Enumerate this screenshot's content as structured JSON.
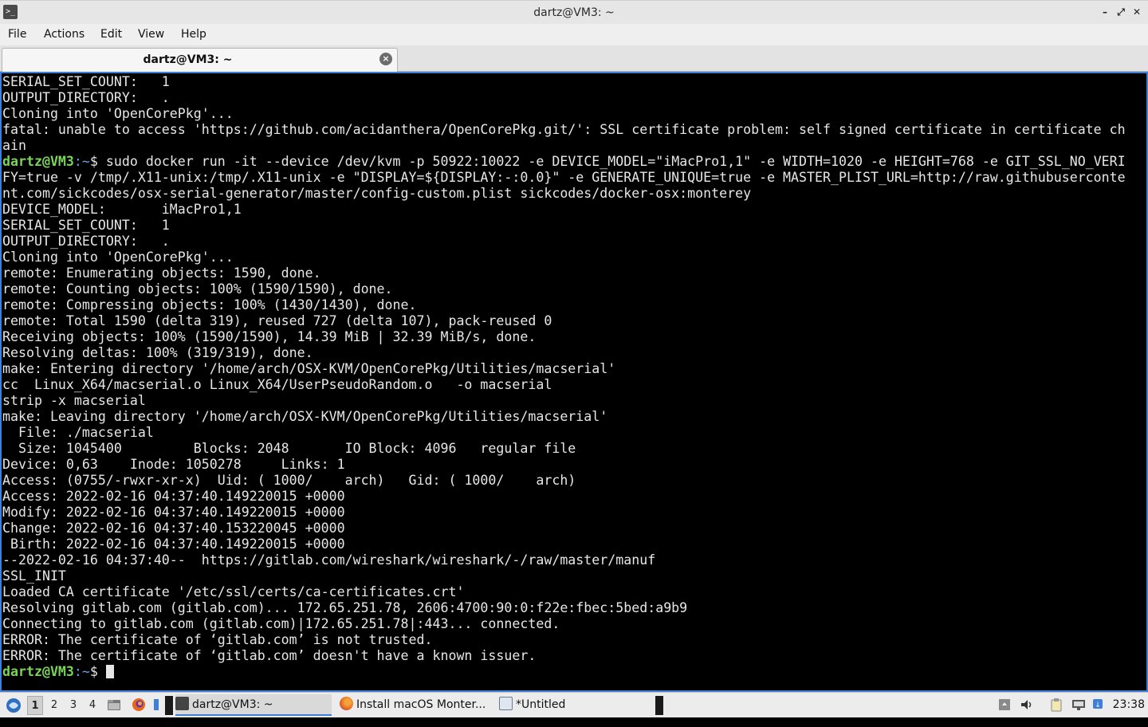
{
  "window": {
    "title": "dartz@VM3: ~",
    "app_icon": "terminal-icon",
    "controls": [
      "minimize-icon",
      "maximize-icon",
      "close-icon"
    ]
  },
  "menubar": {
    "items": [
      "File",
      "Actions",
      "Edit",
      "View",
      "Help"
    ]
  },
  "tabs": [
    {
      "label": "dartz@VM3: ~",
      "close_icon": "close-circle-icon"
    }
  ],
  "terminal": {
    "prompt_user": "dartz@VM3",
    "prompt_path": ":~",
    "prompt_symbol": "$",
    "colors": {
      "background": "#000000",
      "text": "#e6e6e6",
      "prompt_user": "#7cd35a",
      "prompt_path": "#6a9fe6",
      "border": "#3d7fd9"
    },
    "lines": [
      {
        "text": "SERIAL_SET_COUNT:   1"
      },
      {
        "text": "OUTPUT_DIRECTORY:   ."
      },
      {
        "text": "Cloning into 'OpenCorePkg'..."
      },
      {
        "text": "fatal: unable to access 'https://github.com/acidanthera/OpenCorePkg.git/': SSL certificate problem: self signed certificate in certificate ch"
      },
      {
        "text": "ain"
      },
      {
        "prompt": true,
        "text": " sudo docker run -it --device /dev/kvm -p 50922:10022 -e DEVICE_MODEL=\"iMacPro1,1\" -e WIDTH=1020 -e HEIGHT=768 -e GIT_SSL_NO_VERI"
      },
      {
        "text": "FY=true -v /tmp/.X11-unix:/tmp/.X11-unix -e \"DISPLAY=${DISPLAY:-:0.0}\" -e GENERATE_UNIQUE=true -e MASTER_PLIST_URL=http://raw.githubuserconte"
      },
      {
        "text": "nt.com/sickcodes/osx-serial-generator/master/config-custom.plist sickcodes/docker-osx:monterey"
      },
      {
        "text": "DEVICE_MODEL:       iMacPro1,1"
      },
      {
        "text": "SERIAL_SET_COUNT:   1"
      },
      {
        "text": "OUTPUT_DIRECTORY:   ."
      },
      {
        "text": "Cloning into 'OpenCorePkg'..."
      },
      {
        "text": "remote: Enumerating objects: 1590, done."
      },
      {
        "text": "remote: Counting objects: 100% (1590/1590), done."
      },
      {
        "text": "remote: Compressing objects: 100% (1430/1430), done."
      },
      {
        "text": "remote: Total 1590 (delta 319), reused 727 (delta 107), pack-reused 0"
      },
      {
        "text": "Receiving objects: 100% (1590/1590), 14.39 MiB | 32.39 MiB/s, done."
      },
      {
        "text": "Resolving deltas: 100% (319/319), done."
      },
      {
        "text": "make: Entering directory '/home/arch/OSX-KVM/OpenCorePkg/Utilities/macserial'"
      },
      {
        "text": "cc  Linux_X64/macserial.o Linux_X64/UserPseudoRandom.o   -o macserial"
      },
      {
        "text": "strip -x macserial"
      },
      {
        "text": "make: Leaving directory '/home/arch/OSX-KVM/OpenCorePkg/Utilities/macserial'"
      },
      {
        "text": "  File: ./macserial"
      },
      {
        "text": "  Size: 1045400         Blocks: 2048       IO Block: 4096   regular file"
      },
      {
        "text": "Device: 0,63    Inode: 1050278     Links: 1"
      },
      {
        "text": "Access: (0755/-rwxr-xr-x)  Uid: ( 1000/    arch)   Gid: ( 1000/    arch)"
      },
      {
        "text": "Access: 2022-02-16 04:37:40.149220015 +0000"
      },
      {
        "text": "Modify: 2022-02-16 04:37:40.149220015 +0000"
      },
      {
        "text": "Change: 2022-02-16 04:37:40.153220045 +0000"
      },
      {
        "text": " Birth: 2022-02-16 04:37:40.149220015 +0000"
      },
      {
        "text": "--2022-02-16 04:37:40--  https://gitlab.com/wireshark/wireshark/-/raw/master/manuf"
      },
      {
        "text": "SSL_INIT"
      },
      {
        "text": "Loaded CA certificate '/etc/ssl/certs/ca-certificates.crt'"
      },
      {
        "text": "Resolving gitlab.com (gitlab.com)... 172.65.251.78, 2606:4700:90:0:f22e:fbec:5bed:a9b9"
      },
      {
        "text": "Connecting to gitlab.com (gitlab.com)|172.65.251.78|:443... connected."
      },
      {
        "text": "ERROR: The certificate of ‘gitlab.com’ is not trusted."
      },
      {
        "text": "ERROR: The certificate of ‘gitlab.com’ doesn't have a known issuer."
      },
      {
        "prompt": true,
        "text": " ",
        "cursor": true
      }
    ]
  },
  "taskbar": {
    "start_icon": "lxqt-start-icon",
    "workspaces": [
      "1",
      "2",
      "3",
      "4"
    ],
    "active_workspace": "1",
    "quicklaunch": [
      "file-manager-icon",
      "firefox-icon",
      "terminal-icon"
    ],
    "tasks": [
      {
        "label": "dartz@VM3: ~",
        "icon": "terminal-icon",
        "active": true
      },
      {
        "label": "Install macOS Monter...",
        "icon": "firefox-icon",
        "active": false
      },
      {
        "label": "*Untitled",
        "icon": "text-editor-icon",
        "active": false
      }
    ],
    "tray": [
      "notification-icon",
      "volume-icon",
      "clipboard-icon",
      "network-icon",
      "updates-icon"
    ],
    "clock": "23:38"
  }
}
